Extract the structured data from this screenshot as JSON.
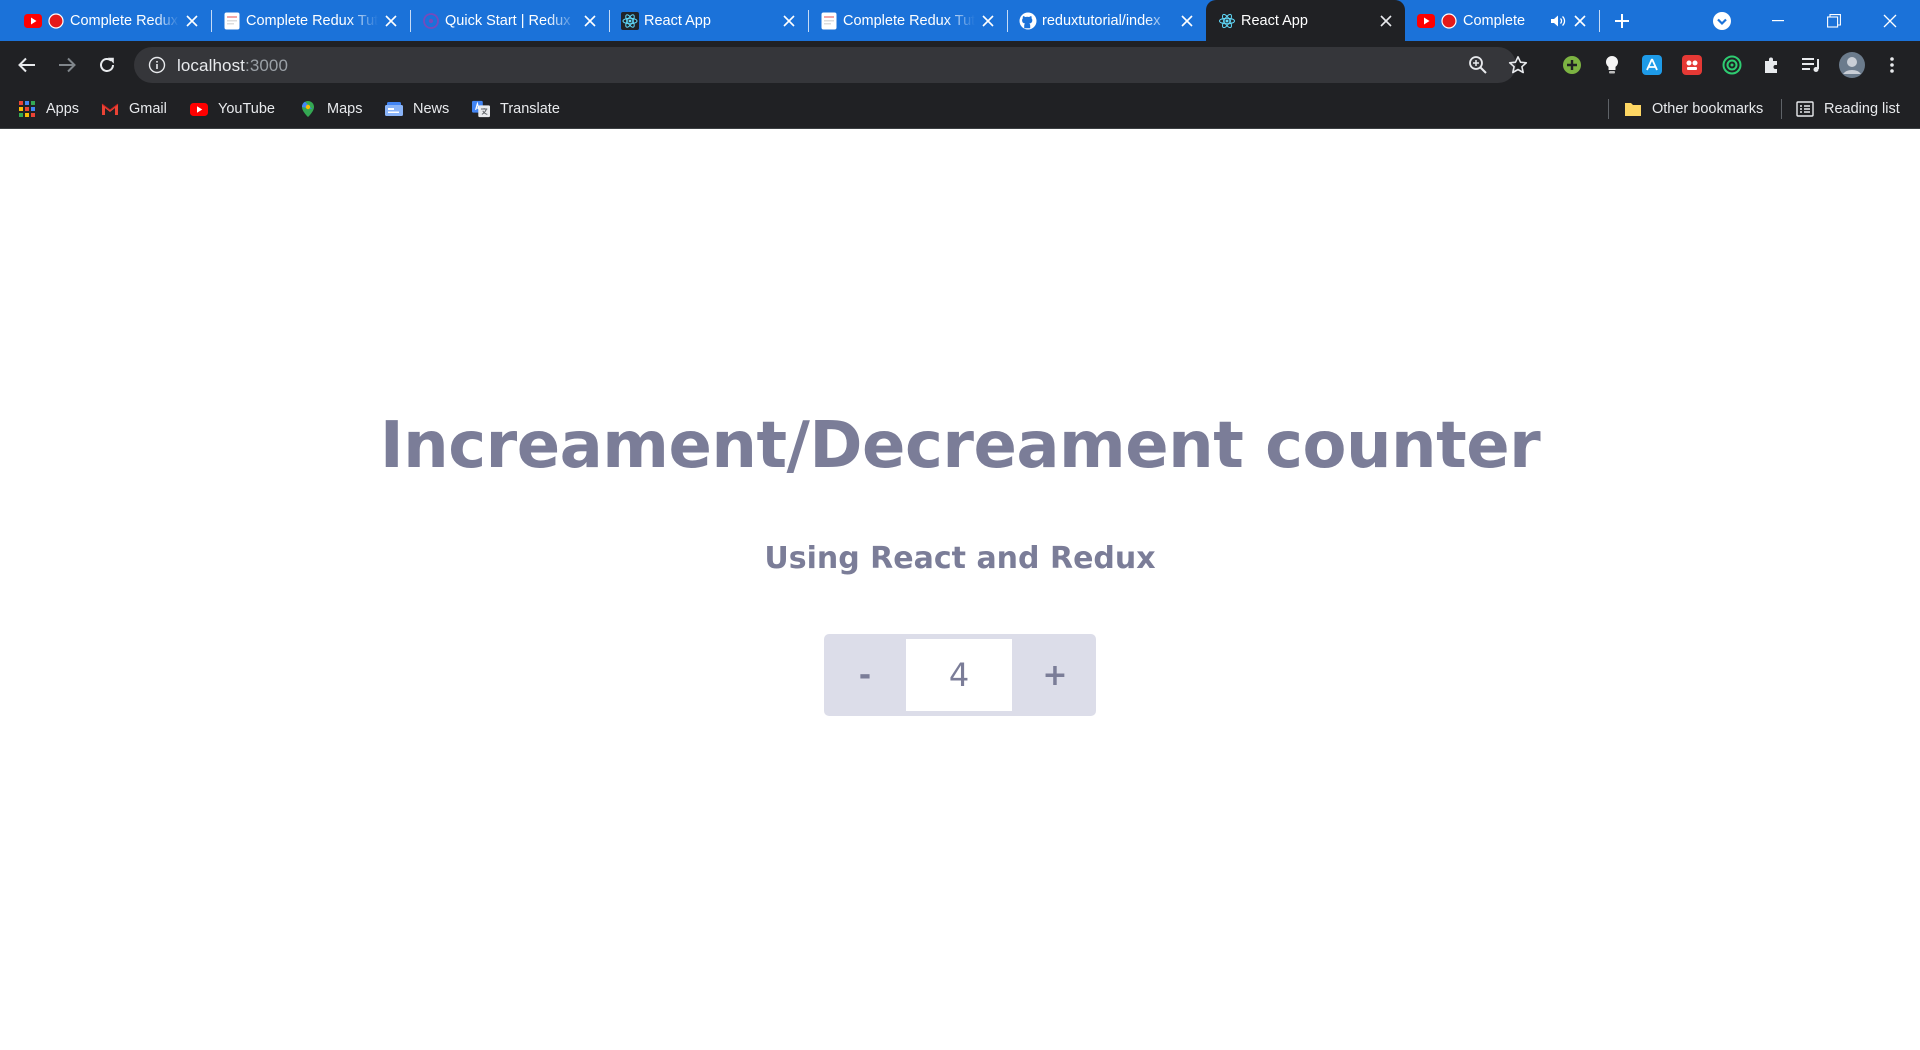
{
  "tabs": [
    {
      "title": "Complete Redux Tutorial",
      "favicon": "youtube-record-icon"
    },
    {
      "title": "Complete Redux Tutorial",
      "favicon": "page-icon"
    },
    {
      "title": "Quick Start | Redux",
      "favicon": "redux-icon"
    },
    {
      "title": "React App",
      "favicon": "react-icon"
    },
    {
      "title": "Complete Redux Tutorial",
      "favicon": "page-icon"
    },
    {
      "title": "reduxtutorial/index",
      "favicon": "github-icon"
    },
    {
      "title": "React App",
      "favicon": "react-icon",
      "active": true
    },
    {
      "title": "Complete",
      "favicon": "youtube-record-icon",
      "audio": true
    }
  ],
  "address": {
    "host": "localhost",
    "port": ":3000"
  },
  "bookmarks": [
    {
      "label": "Apps",
      "icon": "apps-grid-icon"
    },
    {
      "label": "Gmail",
      "icon": "gmail-icon"
    },
    {
      "label": "YouTube",
      "icon": "youtube-icon"
    },
    {
      "label": "Maps",
      "icon": "maps-icon"
    },
    {
      "label": "News",
      "icon": "news-icon"
    },
    {
      "label": "Translate",
      "icon": "translate-icon"
    }
  ],
  "bookmarks_right": {
    "other": "Other bookmarks",
    "reading": "Reading list"
  },
  "page": {
    "heading": "Increament/Decreament counter",
    "subheading": "Using React and Redux",
    "counter": {
      "decrement_label": "-",
      "value": "4",
      "increment_label": "+"
    }
  },
  "colors": {
    "tabstrip": "#1b72d9",
    "toolbar": "#202124",
    "text_accent": "#7b7d98",
    "counter_bg": "#dcdde9"
  }
}
